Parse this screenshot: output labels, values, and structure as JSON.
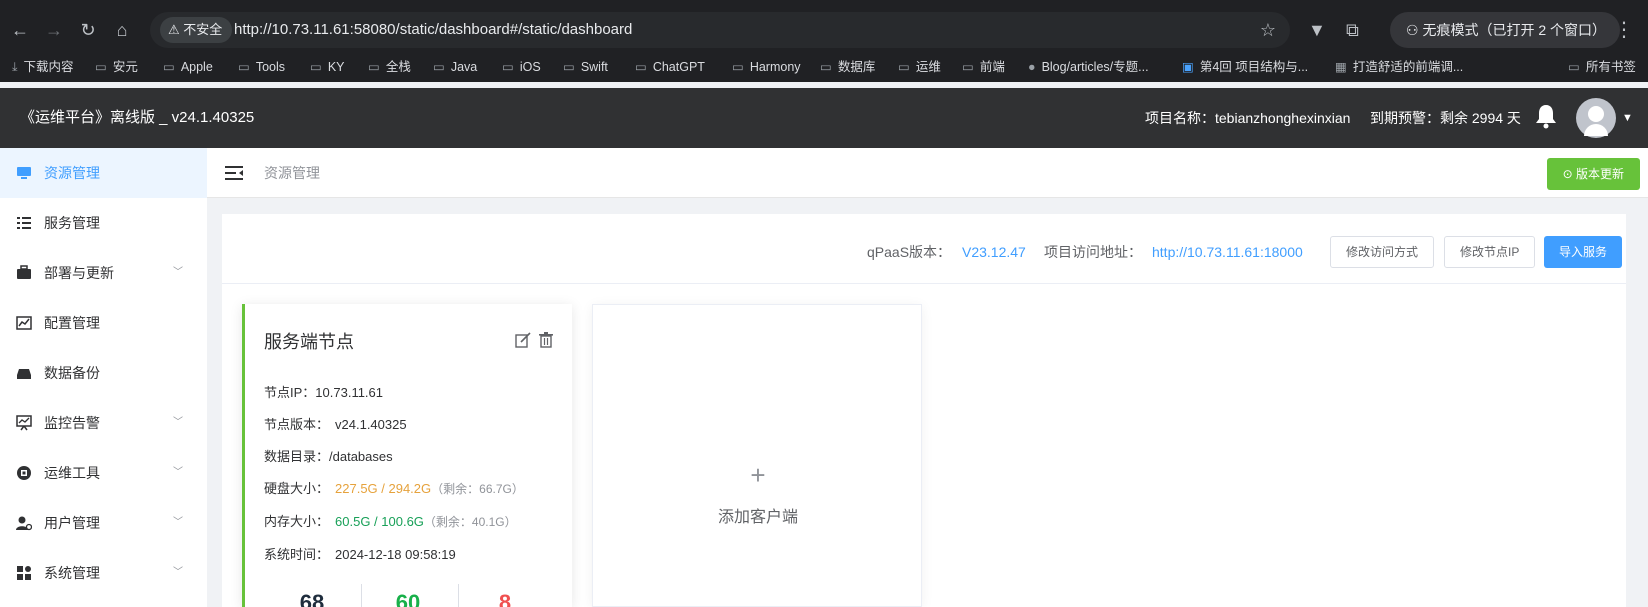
{
  "browser": {
    "insecure_label": "不安全",
    "url": "http://10.73.11.61:58080/static/dashboard#/static/dashboard",
    "incognito_label": "无痕模式（已打开 2 个窗口）",
    "bookmarks": [
      "下载内容",
      "安元",
      "Apple",
      "Tools",
      "KY",
      "全栈",
      "Java",
      "iOS",
      "Swift",
      "ChatGPT",
      "Harmony",
      "数据库",
      "运维",
      "前端",
      "Blog/articles/专题...",
      "第4回 项目结构与...",
      "打造舒适的前端调...",
      "所有书签"
    ]
  },
  "header": {
    "title": "《运维平台》离线版 _ v24.1.40325",
    "project": "项目名称：tebianzhonghexinxian",
    "expiry": "到期预警：剩余 2994 天"
  },
  "sidebar": {
    "items": [
      {
        "label": "资源管理",
        "icon": "monitor-icon"
      },
      {
        "label": "服务管理",
        "icon": "list-icon"
      },
      {
        "label": "部署与更新",
        "icon": "briefcase-icon"
      },
      {
        "label": "配置管理",
        "icon": "chart-icon"
      },
      {
        "label": "数据备份",
        "icon": "drive-icon"
      },
      {
        "label": "监控告警",
        "icon": "monitor-chart-icon"
      },
      {
        "label": "运维工具",
        "icon": "tool-icon"
      },
      {
        "label": "用户管理",
        "icon": "user-gear-icon"
      },
      {
        "label": "系统管理",
        "icon": "grid-icon"
      }
    ]
  },
  "topbar": {
    "breadcrumb": "资源管理",
    "update_label": "版本更新"
  },
  "panel": {
    "version_label": "qPaaS版本：",
    "version_value": "V23.12.47",
    "address_label": "项目访问地址：",
    "address_value": "http://10.73.11.61:18000",
    "btn_modify_access": "修改访问方式",
    "btn_modify_ip": "修改节点IP",
    "btn_import": "导入服务"
  },
  "server_card": {
    "title": "服务端节点",
    "ip_label": "节点IP：",
    "ip_value": "10.73.11.61",
    "version_label": "节点版本：",
    "version_value": "v24.1.40325",
    "dir_label": "数据目录：",
    "dir_value": "/databases",
    "disk_label": "硬盘大小：",
    "disk_value": "227.5G / 294.2G",
    "disk_remaining": "（剩余：66.7G）",
    "mem_label": "内存大小：",
    "mem_value": "60.5G / 100.6G",
    "mem_remaining": "（剩余：40.1G）",
    "time_label": "系统时间：",
    "time_value": "2024-12-18 09:58:19",
    "stats": [
      "68",
      "60",
      "8"
    ],
    "stat_colors": [
      "#1f2d3d",
      "#18b04a",
      "#f05050"
    ]
  },
  "add_card": {
    "plus": "+",
    "label": "添加客户端"
  },
  "colors": {
    "primary": "#409eff",
    "success": "#67c23a",
    "header_bg": "#303133"
  }
}
